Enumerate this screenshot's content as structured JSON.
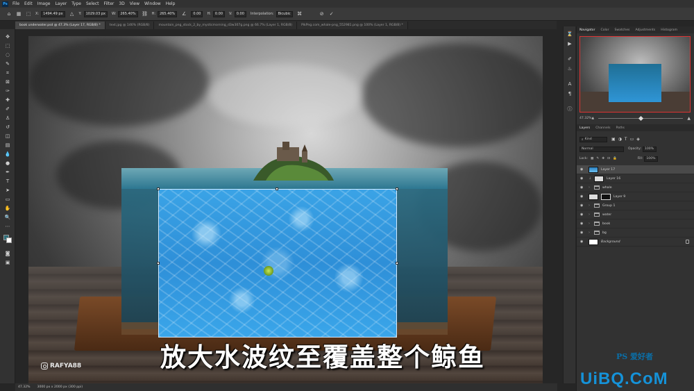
{
  "app": {
    "logo": "Ps"
  },
  "menu": [
    "File",
    "Edit",
    "Image",
    "Layer",
    "Type",
    "Select",
    "Filter",
    "3D",
    "View",
    "Window",
    "Help"
  ],
  "options": {
    "x_label": "X:",
    "x_value": "1494.49 px",
    "y_label": "Y:",
    "y_value": "1029.03 px",
    "w_label": "W:",
    "w_value": "265.40%",
    "h_label": "H:",
    "h_value": "265.40%",
    "angle_value": "0.00",
    "hskew_label": "H:",
    "hskew_value": "0.00",
    "vskew_label": "V:",
    "vskew_value": "0.00",
    "interp_label": "Interpolation:",
    "interp_value": "Bicubic"
  },
  "tabs": [
    {
      "label": "book underwater.psd @ 47.3% (Layer 17, RGB/8) *"
    },
    {
      "label": "text.jpg @ 146% (RGB/8)"
    },
    {
      "label": "mountain_png_stock_2_by_mysticmorning_d3w307g.png @ 66.7% (Layer 1, RGB/8)"
    },
    {
      "label": "PikPng.com_whale-png_552981.png @ 100% (Layer 1, RGB/8) *"
    }
  ],
  "canvas": {
    "subtitle": "放大水波纹至覆盖整个鲸鱼",
    "watermark": "RAFYA88"
  },
  "status": {
    "zoom": "47.32%",
    "doc": "3000 px x 2000 px (300 ppi)"
  },
  "panels": {
    "top_tabs": [
      "Navigator",
      "Color",
      "Swatches",
      "Adjustments",
      "Histogram"
    ],
    "nav_zoom": "47.32%",
    "layer_tabs": [
      "Layers",
      "Channels",
      "Paths"
    ],
    "kind_label": "Kind",
    "blend_mode": "Normal",
    "opacity_label": "Opacity:",
    "opacity_value": "100%",
    "lock_label": "Lock:",
    "fill_label": "Fill:",
    "fill_value": "100%"
  },
  "layers": [
    {
      "name": "Layer 17",
      "thumb": "blue",
      "selected": true
    },
    {
      "name": "Layer 16",
      "thumb": "white"
    },
    {
      "name": "whale",
      "thumb": "folder"
    },
    {
      "name": "Layer 9",
      "thumb": "mask"
    },
    {
      "name": "Group 1",
      "thumb": "folder"
    },
    {
      "name": "water",
      "thumb": "folder"
    },
    {
      "name": "book",
      "thumb": "folder"
    },
    {
      "name": "bg",
      "thumb": "folder"
    },
    {
      "name": "Background",
      "thumb": "white",
      "italic": true
    }
  ],
  "branding": {
    "ps_logo": "PS 爱好者",
    "site": "UiBQ.CoM"
  }
}
